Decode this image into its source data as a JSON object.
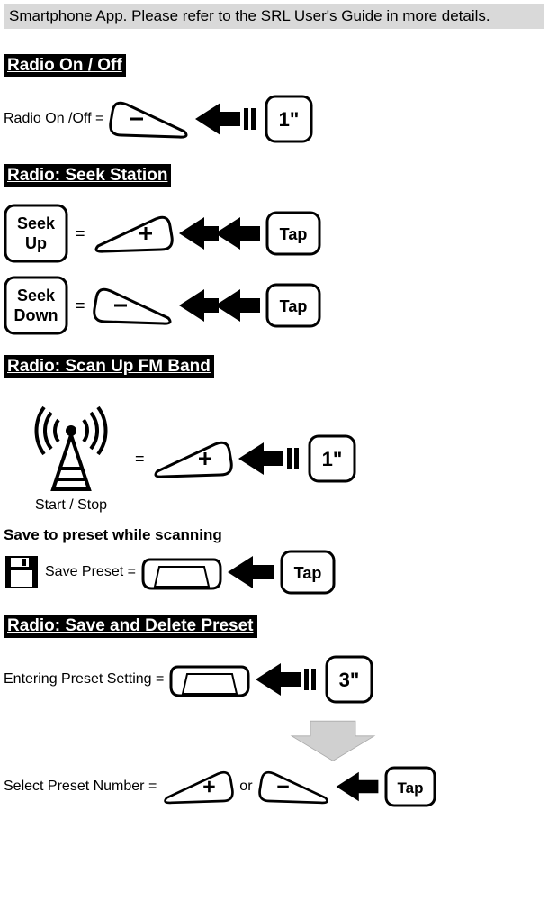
{
  "top_note": "Smartphone App. Please refer to the SRL User's Guide in more details.",
  "sections": {
    "radio_on_off": {
      "header": "Radio On / Off",
      "label": "Radio On /Off =",
      "duration": "1\""
    },
    "seek": {
      "header": "Radio: Seek Station",
      "seek_up": "Seek\nUp",
      "seek_down": "Seek\nDown",
      "tap": "Tap"
    },
    "scan": {
      "header": "Radio: Scan Up FM Band",
      "caption": "Start / Stop",
      "duration": "1\""
    },
    "save_scan": {
      "subhead": "Save to preset while scanning",
      "label": "Save Preset =",
      "tap": "Tap"
    },
    "preset": {
      "header": "Radio: Save and Delete Preset",
      "enter_label": "Entering Preset Setting =",
      "duration": "3\"",
      "select_label": "Select Preset Number =",
      "or": " or ",
      "tap": "Tap"
    }
  }
}
